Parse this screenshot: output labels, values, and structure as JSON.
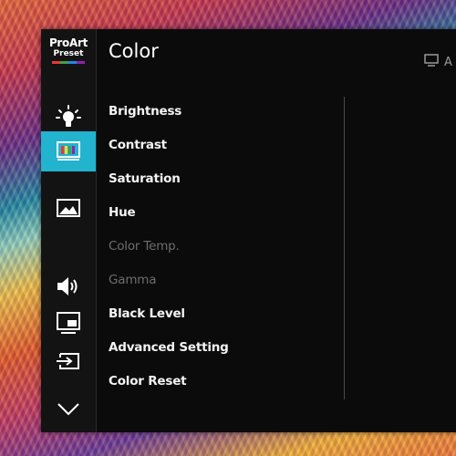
{
  "brand": {
    "line1": "ProArt",
    "line2": "Preset"
  },
  "header": {
    "title": "Color",
    "right_label": "A"
  },
  "sidebar": {
    "items": [
      {
        "name": "brightness-icon"
      },
      {
        "name": "color-icon",
        "active": true
      },
      {
        "name": "image-icon"
      },
      {
        "name": "sound-icon"
      },
      {
        "name": "pip-icon"
      },
      {
        "name": "input-select-icon"
      },
      {
        "name": "chevron-down-icon"
      }
    ]
  },
  "menu": {
    "items": [
      {
        "label": "Brightness",
        "enabled": true
      },
      {
        "label": "Contrast",
        "enabled": true
      },
      {
        "label": "Saturation",
        "enabled": true
      },
      {
        "label": "Hue",
        "enabled": true
      },
      {
        "label": "Color Temp.",
        "enabled": false
      },
      {
        "label": "Gamma",
        "enabled": false
      },
      {
        "label": "Black Level",
        "enabled": true
      },
      {
        "label": "Advanced Setting",
        "enabled": true
      },
      {
        "label": "Color Reset",
        "enabled": true
      }
    ]
  },
  "colors": {
    "accent": "#22b3cf",
    "panel": "#0c0b0c",
    "text": "#f4f4f4",
    "disabled_text": "#6e6e6e"
  }
}
